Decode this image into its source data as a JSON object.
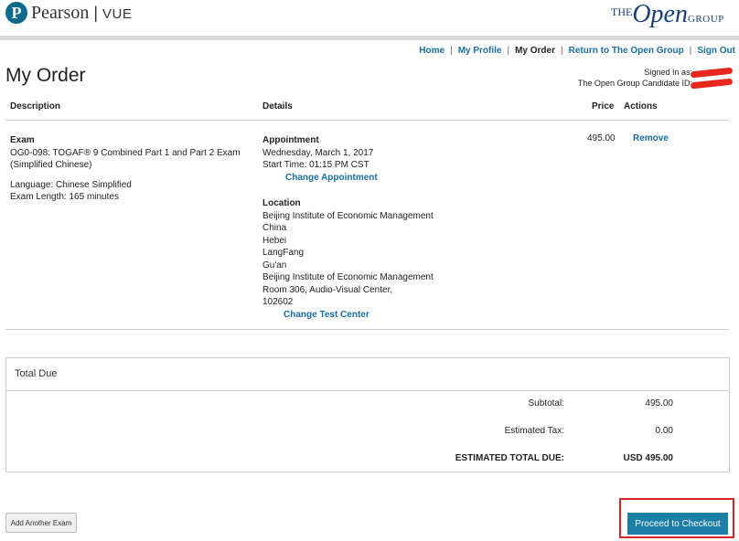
{
  "header": {
    "pearson_logo_letter": "P",
    "pearson_word": "Pearson",
    "pearson_sep": "|",
    "pearson_vue": "VUE",
    "open_logo": {
      "the": "THE",
      "open": "Open",
      "group": "GROUP"
    }
  },
  "nav": {
    "items": [
      {
        "label": "Home"
      },
      {
        "label": "My Profile"
      },
      {
        "label": "My Order"
      },
      {
        "label": "Return to The Open Group"
      },
      {
        "label": "Sign Out"
      }
    ],
    "separator": "|"
  },
  "page_title": "My Order",
  "signed_in": {
    "line1": "Signed In as:",
    "line2": "The Open Group Candidate ID:"
  },
  "table": {
    "headers": {
      "description": "Description",
      "details": "Details",
      "price": "Price",
      "actions": "Actions"
    },
    "row": {
      "type_label": "Exam",
      "exam_name_line1": "OG0-098: TOGAF® 9 Combined Part 1 and Part 2 Exam",
      "exam_name_line2": "(Simplified Chinese)",
      "language": "Language: Chinese Simplified",
      "exam_length": "Exam Length: 165 minutes",
      "appointment_heading": "Appointment",
      "appointment_date": "Wednesday, March 1, 2017",
      "appointment_time": "Start Time: 01:15 PM CST",
      "change_appointment": "Change Appointment",
      "location_heading": "Location",
      "location_lines": [
        "Beijing Institute of Economic Management",
        "China",
        "Hebei",
        "LangFang",
        "Gu'an",
        "Beijing Institute of Economic Management",
        "Room 306, Audio-Visual Center,",
        "102602"
      ],
      "change_test_center": "Change Test Center",
      "price": "495.00",
      "remove": "Remove"
    }
  },
  "total": {
    "heading": "Total Due",
    "subtotal_label": "Subtotal:",
    "subtotal_value": "495.00",
    "tax_label": "Estimated Tax:",
    "tax_value": "0.00",
    "total_label": "ESTIMATED TOTAL DUE:",
    "total_value": "USD 495.00"
  },
  "buttons": {
    "add_exam": "Add Another Exam",
    "checkout": "Proceed to Checkout"
  },
  "colors": {
    "link": "#1a6ea0",
    "checkout_bg": "#1a7ea6",
    "highlight_outline": "#d8232a",
    "redaction": "#e8261e",
    "brand_open_group": "#1a3f78"
  }
}
